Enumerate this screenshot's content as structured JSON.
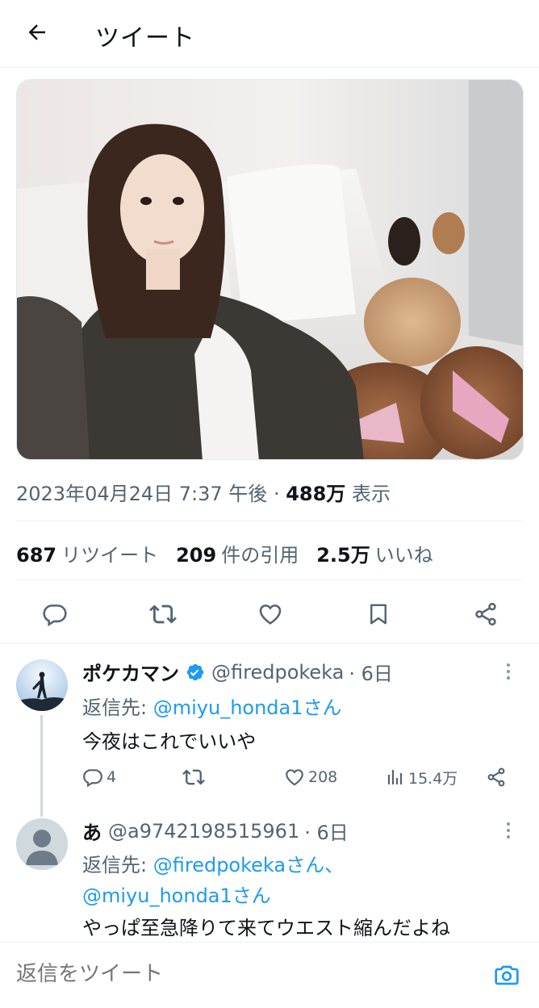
{
  "header": {
    "title": "ツイート"
  },
  "tweet": {
    "photo_alt": "",
    "datetime": "2023年04月24日 7:37 午後",
    "separator": " · ",
    "views_count": "488万",
    "views_label": "表示",
    "stats": {
      "retweets_count": "687",
      "retweets_label": "リツイート",
      "quotes_count": "209",
      "quotes_label": "件の引用",
      "likes_count": "2.5万",
      "likes_label": "いいね"
    }
  },
  "replies": [
    {
      "name": "ポケカマン",
      "verified": true,
      "handle": "@firedpokeka",
      "time": "· 6日",
      "reply_to_label": "返信先:",
      "reply_to_line1": "@miyu_honda1さん",
      "reply_to_line2": "",
      "text": "今夜はこれでいいや",
      "reply_count": "4",
      "retweet_count": "",
      "like_count": "208",
      "view_count": "15.4万"
    },
    {
      "name": "あ",
      "verified": false,
      "handle": "@a9742198515961",
      "time": "· 6日",
      "reply_to_label": "返信先:",
      "reply_to_line1": "@firedpokekaさん、",
      "reply_to_line2": "@miyu_honda1さん",
      "text": "やっぱ至急降りて来てウエスト縮んだよね"
    }
  ],
  "composer": {
    "placeholder": "返信をツイート"
  },
  "colors": {
    "accent": "#1d9bf0",
    "muted": "#536471",
    "text": "#0f1419",
    "divider": "#eff3f4"
  }
}
